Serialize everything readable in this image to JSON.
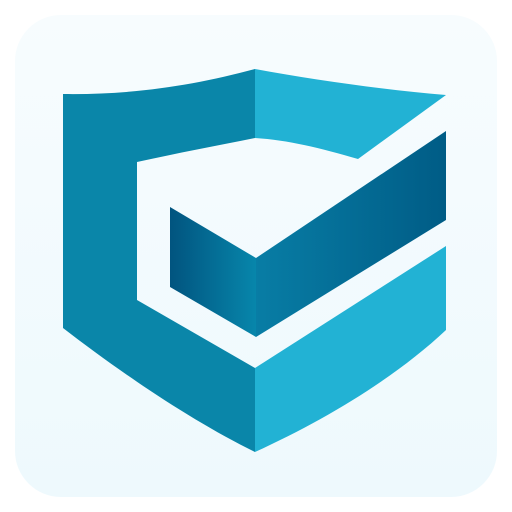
{
  "app_icon": {
    "name": "shield-check-icon",
    "colors": {
      "tile_top": "#F7FCFE",
      "tile_bottom": "#EEF9FD",
      "shield_dark": "#0A86A9",
      "shield_light": "#22B2D4",
      "check_front_dark": "#01547F",
      "check_front_mid": "#0786AB",
      "check_right_dark": "#005C86",
      "check_right_mid": "#087DA5"
    }
  }
}
